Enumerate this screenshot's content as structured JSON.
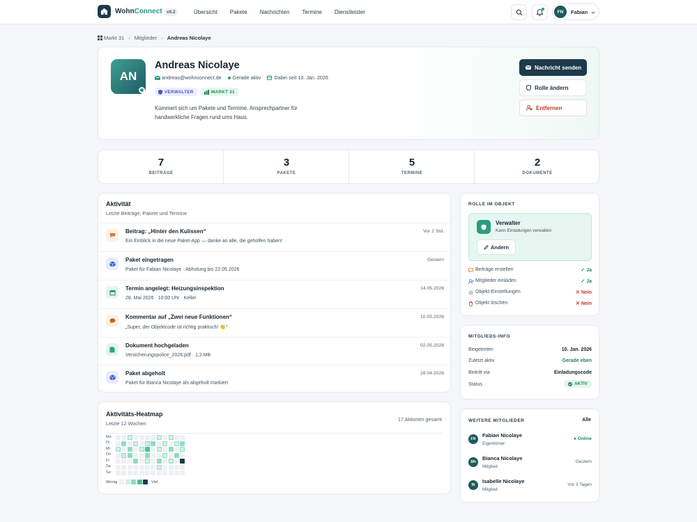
{
  "nav": {
    "brand_a": "Wohn",
    "brand_b": "Connect",
    "version": "v0.2",
    "links": [
      "Übersicht",
      "Pakete",
      "Nachrichten",
      "Termine",
      "Dienstleister"
    ],
    "user_initials": "FN",
    "user_name": "Fabian"
  },
  "breadcrumb": [
    "Markt 31",
    "Mitglieder",
    "Andreas Nicolaye"
  ],
  "profile": {
    "initials": "AN",
    "name": "Andreas Nicolaye",
    "email": "andreas@wohnconnect.de",
    "status": "Gerade aktiv",
    "since": "Dabei seit 10. Jan. 2026",
    "tag_role": "VERWALTER",
    "tag_place": "MARKT 31",
    "description": "Kümmert sich um Pakete und Termine. Ansprechpartner für handwerkliche Fragen rund ums Haus.",
    "btn_message": "Nachricht senden",
    "btn_role": "Rolle ändern",
    "btn_remove": "Entfernen"
  },
  "stats": [
    {
      "n": "7",
      "l": "BEITRÄGE"
    },
    {
      "n": "3",
      "l": "PAKETE"
    },
    {
      "n": "5",
      "l": "TERMINE"
    },
    {
      "n": "2",
      "l": "DOKUMENTE"
    }
  ],
  "activity": {
    "title": "Aktivität",
    "subtitle": "Letzte Beiträge, Pakete und Termine",
    "items": [
      {
        "icon": "chat-icon",
        "title": "Beitrag: „Hinter den Kulissen“",
        "sub": "Ein Einblick in die neue Paket-App — danke an alle, die geholfen haben!",
        "time": "Vor 2 Std."
      },
      {
        "icon": "package-icon",
        "title": "Paket eingetragen",
        "sub": "Paket für Fabian Nicolaye · Abholung bis 22.05.2026",
        "time": "Gestern"
      },
      {
        "icon": "calendar-icon",
        "title": "Termin angelegt: Heizungsinspektion",
        "sub": "28. Mai 2026 · 10:00 Uhr · Keller",
        "time": "14.05.2026"
      },
      {
        "icon": "comment-icon",
        "title": "Kommentar auf „Zwei neue Funktionen“",
        "sub": "„Super, der Objektcode ist richtig praktisch! 👏“",
        "time": "10.05.2026"
      },
      {
        "icon": "document-icon",
        "title": "Dokument hochgeladen",
        "sub": "Versicherungspolice_2026.pdf · 1,2 MB",
        "time": "02.05.2026"
      },
      {
        "icon": "package-icon",
        "title": "Paket abgeholt",
        "sub": "Paket für Bianca Nicolaye als abgeholt markiert",
        "time": "28.04.2026"
      }
    ]
  },
  "heatmap": {
    "title": "Aktivitäts-Heatmap",
    "subtitle": "Letzte 12 Wochen",
    "total": "17 Aktionen gesamt",
    "days": [
      "Mo",
      "Di",
      "Mi",
      "Do",
      "Fr",
      "Sa",
      "So"
    ],
    "less": "Wenig",
    "more": "Viel",
    "levels": [
      [
        0,
        0,
        1,
        0,
        0,
        0,
        0,
        1,
        0,
        1,
        0,
        0
      ],
      [
        0,
        2,
        0,
        1,
        0,
        1,
        2,
        0,
        1,
        0,
        1,
        2
      ],
      [
        1,
        0,
        2,
        0,
        1,
        3,
        0,
        1,
        0,
        2,
        0,
        1
      ],
      [
        0,
        1,
        2,
        0,
        0,
        2,
        0,
        0,
        1,
        0,
        2,
        0
      ],
      [
        0,
        0,
        0,
        2,
        0,
        1,
        0,
        2,
        0,
        1,
        0,
        4
      ],
      [
        0,
        0,
        0,
        0,
        0,
        0,
        0,
        1,
        0,
        0,
        0,
        0
      ],
      [
        0,
        0,
        0,
        0,
        0,
        0,
        0,
        0,
        0,
        0,
        0,
        0
      ]
    ],
    "colors": [
      "#eef1f4",
      "#d4f0e6",
      "#8fdcc0",
      "#45c29a",
      "#1c3a4a"
    ]
  },
  "role": {
    "title": "ROLLE IM OBJEKT",
    "name": "Verwalter",
    "desc": "Kann Einladungen verwalten",
    "btn": "Ändern",
    "perms": [
      {
        "label": "Beiträge erstellen",
        "value": "Ja",
        "ok": true,
        "icon": "chat-icon"
      },
      {
        "label": "Mitglieder einladen",
        "value": "Ja",
        "ok": true,
        "icon": "user-add-icon"
      },
      {
        "label": "Objekt-Einstellungen",
        "value": "Nein",
        "ok": false,
        "icon": "gear-icon"
      },
      {
        "label": "Objekt löschen",
        "value": "Nein",
        "ok": false,
        "icon": "trash-icon"
      }
    ]
  },
  "info": {
    "title": "MITGLIEDS-INFO",
    "rows": [
      {
        "label": "Beigetreten",
        "value": "10. Jan. 2026"
      },
      {
        "label": "Zuletzt aktiv",
        "value": "Gerade eben"
      },
      {
        "label": "Beitritt via",
        "value": "Einladungscode"
      },
      {
        "label": "Status",
        "value": "AKTIV"
      }
    ]
  },
  "members": {
    "title": "WEITERE MITGLIEDER",
    "all": "Alle",
    "items": [
      {
        "initials": "FN",
        "name": "Fabian Nicolaye",
        "role": "Eigentümer",
        "status": "● Online"
      },
      {
        "initials": "BN",
        "name": "Bianca Nicolaye",
        "role": "Mitglied",
        "status": "Gestern"
      },
      {
        "initials": "IN",
        "name": "Isabelle Nicolaye",
        "role": "Mitglied",
        "status": "Vor 3 Tagen"
      }
    ]
  }
}
